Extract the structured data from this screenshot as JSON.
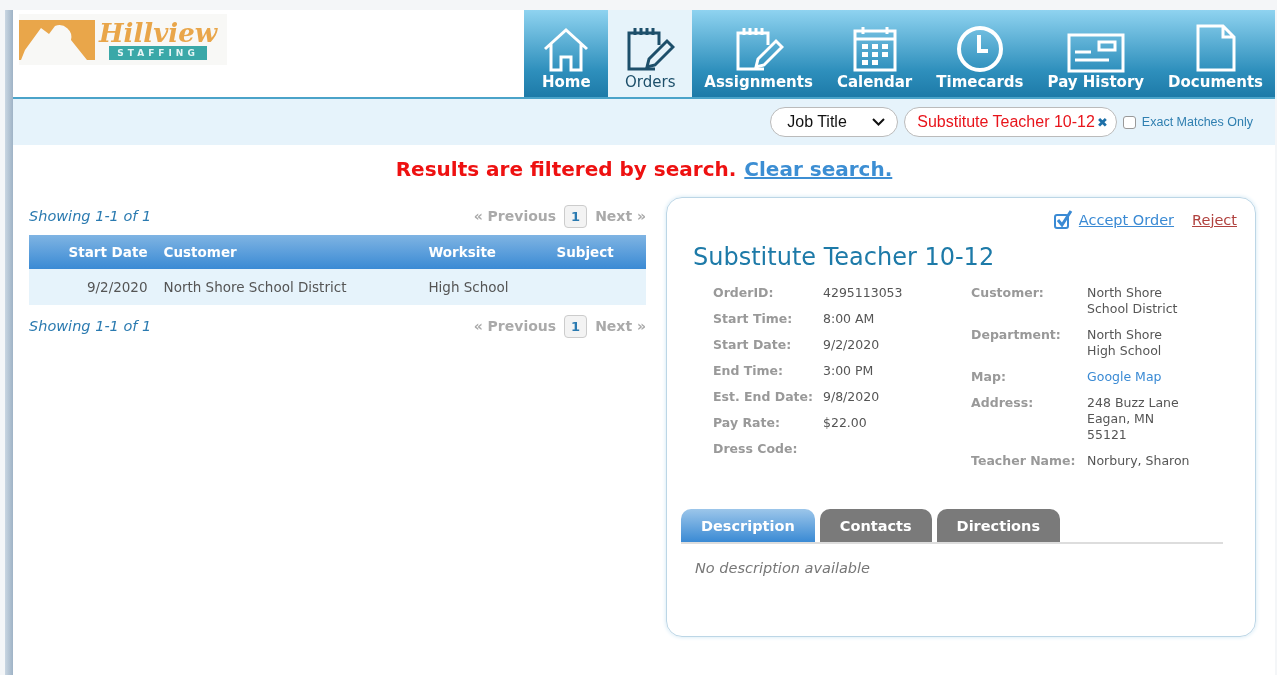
{
  "logo": {
    "name": "Hillview",
    "tagline": "STAFFING"
  },
  "nav": [
    {
      "label": "Home",
      "selected": false
    },
    {
      "label": "Orders",
      "selected": true
    },
    {
      "label": "Assignments",
      "selected": false
    },
    {
      "label": "Calendar",
      "selected": false
    },
    {
      "label": "Timecards",
      "selected": false
    },
    {
      "label": "Pay History",
      "selected": false
    },
    {
      "label": "Documents",
      "selected": false
    }
  ],
  "filter": {
    "field": "Job Title",
    "query": "Substitute Teacher 10-12",
    "clear_icon": "✖",
    "exact_label": "Exact Matches Only",
    "exact_checked": false
  },
  "notice": {
    "text": "Results are filtered by search.",
    "link": "Clear search."
  },
  "pager_top": {
    "showing": "Showing 1-1 of 1",
    "previous": "« Previous",
    "page": "1",
    "next": "Next »"
  },
  "table": {
    "columns": [
      "Start Date",
      "Customer",
      "Worksite",
      "Subject"
    ],
    "rows": [
      {
        "cells": [
          "9/2/2020",
          "North Shore School District",
          "High School"
        ],
        "selected": false
      }
    ]
  },
  "pager_bottom": {
    "showing": "Showing 1-1 of 1",
    "previous": "« Previous",
    "page": "1",
    "next": "Next »"
  },
  "detail": {
    "accept": "Accept Order",
    "reject": "Reject",
    "title": "Substitute Teacher 10-12",
    "left": [
      {
        "label": "OrderID:",
        "value": "4295113053"
      },
      {
        "label": "Start Time:",
        "value": "8:00 AM"
      },
      {
        "label": "Start Date:",
        "value": "9/2/2020"
      },
      {
        "label": "End Time:",
        "value": "3:00 PM"
      },
      {
        "label": "Est. End Date:",
        "value": "9/8/2020"
      },
      {
        "label": "Pay Rate:",
        "value": "$22.00"
      },
      {
        "label": "Dress Code:"
      }
    ],
    "right": [
      {
        "label": "Customer:",
        "value": "North Shore\nSchool District",
        "kind": "text"
      },
      {
        "label": "Department:",
        "value": "North Shore\nHigh School",
        "kind": "text"
      },
      {
        "label": "Map:",
        "value": "Google Map",
        "kind": "link"
      },
      {
        "label": "Address:",
        "value": "248 Buzz Lane\nEagan, MN\n55121",
        "kind": "text"
      },
      {
        "label": "Teacher Name:",
        "value": "Norbury, Sharon",
        "kind": "text"
      }
    ],
    "tabs": [
      {
        "label": "Description",
        "selected": true
      },
      {
        "label": "Contacts",
        "selected": false
      },
      {
        "label": "Directions",
        "selected": false
      }
    ],
    "description": "No description available"
  }
}
